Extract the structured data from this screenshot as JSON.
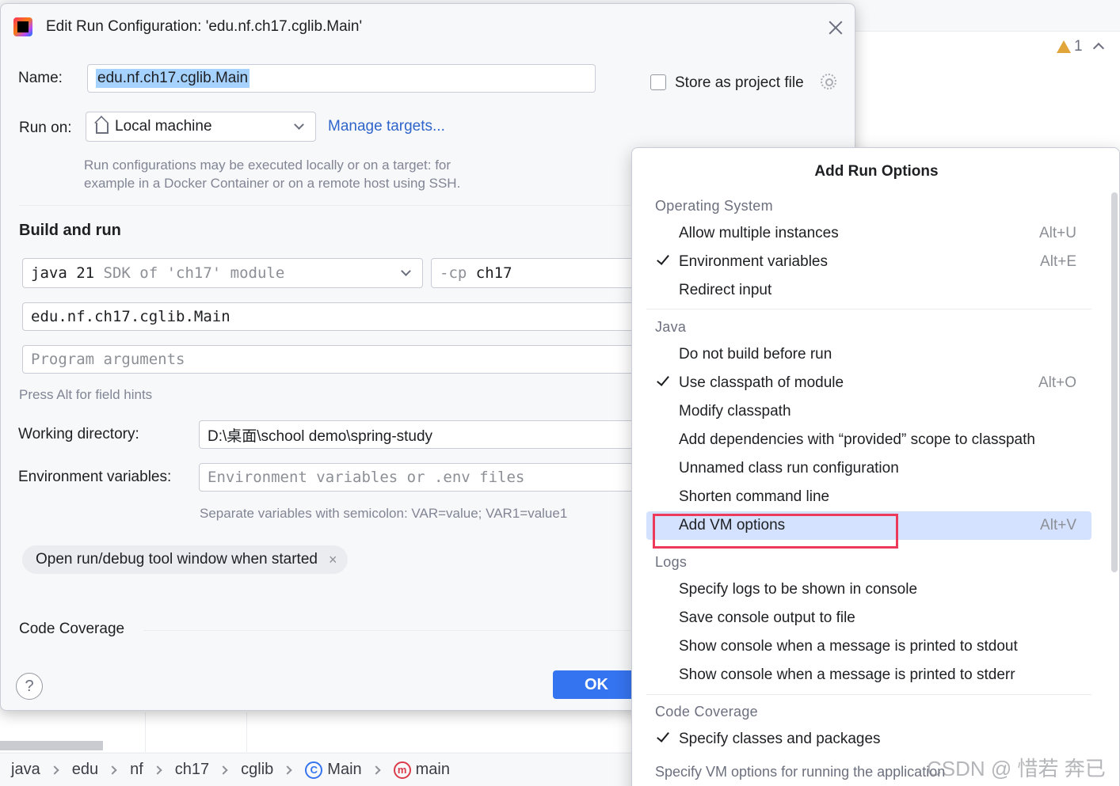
{
  "ide": {
    "inspection_count": "1"
  },
  "breadcrumb": [
    "java",
    "edu",
    "nf",
    "ch17",
    "cglib",
    "Main",
    "main"
  ],
  "dialog": {
    "title": "Edit Run Configuration: 'edu.nf.ch17.cglib.Main'",
    "name_label": "Name:",
    "name_value": "edu.nf.ch17.cglib.Main",
    "store_label": "Store as project file",
    "run_on_label": "Run on:",
    "run_on_value": "Local machine",
    "manage_targets": "Manage targets...",
    "run_on_hint": [
      "Run configurations may be executed locally or on a target: for",
      "example in a Docker Container or on a remote host using SSH."
    ],
    "build_and_run": "Build and run",
    "jdk_value": "java 21",
    "jdk_suffix": "SDK of 'ch17' module",
    "cp_prefix": "-cp",
    "cp_value": "ch17",
    "main_class": "edu.nf.ch17.cglib.Main",
    "program_args_placeholder": "Program arguments",
    "field_hints": "Press Alt for field hints",
    "working_dir_label": "Working directory:",
    "working_dir_value": "D:\\桌面\\school demo\\spring-study",
    "env_label": "Environment variables:",
    "env_placeholder": "Environment variables or .env files",
    "env_hint": "Separate variables with semicolon: VAR=value; VAR1=value1",
    "chip_label": "Open run/debug tool window when started",
    "chip_close": "×",
    "code_coverage": "Code Coverage",
    "help": "?",
    "ok": "OK"
  },
  "popup": {
    "title": "Add Run Options",
    "groups": {
      "os": "Operating System",
      "java": "Java",
      "logs": "Logs",
      "coverage": "Code Coverage"
    },
    "options": {
      "allow_multiple": {
        "label": "Allow multiple instances",
        "shortcut": "Alt+U"
      },
      "env_vars": {
        "label": "Environment variables",
        "shortcut": "Alt+E"
      },
      "redirect_input": {
        "label": "Redirect input"
      },
      "do_not_build": {
        "label": "Do not build before run"
      },
      "use_classpath": {
        "label": "Use classpath of module",
        "shortcut": "Alt+O"
      },
      "modify_classpath": {
        "label": "Modify classpath"
      },
      "add_deps": {
        "label": "Add dependencies with “provided” scope to classpath"
      },
      "unnamed_class": {
        "label": "Unnamed class run configuration"
      },
      "shorten_cmd": {
        "label": "Shorten command line"
      },
      "add_vm": {
        "label": "Add VM options",
        "shortcut": "Alt+V"
      },
      "specify_logs": {
        "label": "Specify logs to be shown in console"
      },
      "save_console": {
        "label": "Save console output to file"
      },
      "show_stdout": {
        "label": "Show console when a message is printed to stdout"
      },
      "show_stderr": {
        "label": "Show console when a message is printed to stderr"
      },
      "specify_classes": {
        "label": "Specify classes and packages"
      }
    },
    "description": "Specify VM options for running the application"
  },
  "watermark": "CSDN @ 惜若 奔已",
  "colors": {
    "accent": "#3574f0",
    "selection": "#d4e2ff",
    "highlight_box": "#ee3a5a",
    "link": "#2f65ca"
  }
}
